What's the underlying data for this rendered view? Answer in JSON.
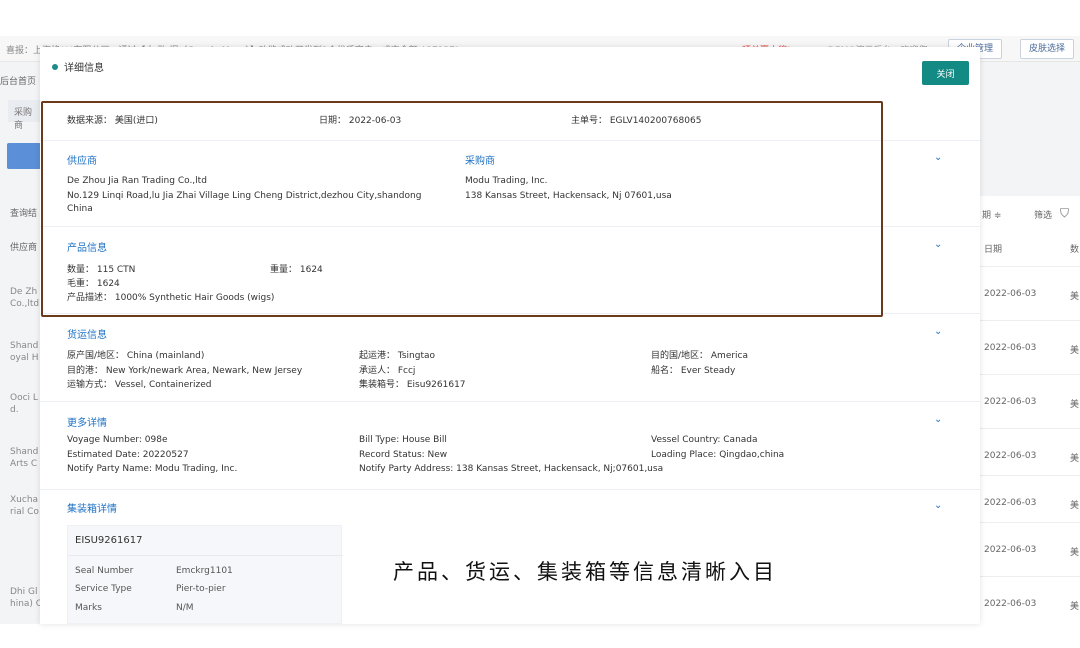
{
  "background": {
    "notice": "喜报：上海格***有限公司，通过【大 数 据（Google Maps）】功能成功开发到1个优质客户，成交金额 $17137!",
    "red_link": "晒单赢大奖!",
    "demo_text": "DEMO演示后台，欢迎您",
    "btn_enterprise": "企业管理",
    "btn_skin": "皮肤选择",
    "nav_home": "后台首页",
    "tab_purchase": "采购商",
    "label_query": "查询结",
    "label_supplier": "供应商",
    "right_hdr_date_sort": "期 ≑",
    "right_hdr_filter": "筛选",
    "right_hdr_date": "日期",
    "right_hdr_count": "数",
    "left_rows": [
      "De Zh",
      "Co.,ltd",
      "Shand",
      "oyal H",
      "Ooci L",
      "d.",
      "Shand",
      "Arts C",
      "Xucha",
      "rial Co",
      "Dhi Gl",
      "hina) C"
    ],
    "right_rows": [
      {
        "date": "2022-06-03",
        "mark": "美"
      },
      {
        "date": "2022-06-03",
        "mark": "美"
      },
      {
        "date": "2022-06-03",
        "mark": "美"
      },
      {
        "date": "2022-06-03",
        "mark": "美"
      },
      {
        "date": "2022-06-03",
        "mark": "美"
      },
      {
        "date": "2022-06-03",
        "mark": "美"
      },
      {
        "date": "2022-06-03",
        "mark": "美"
      }
    ]
  },
  "modal": {
    "title": "详细信息",
    "close_label": "关闭",
    "summary": {
      "source": "数据来源：  美国(进口)",
      "date": "日期：  2022-06-03",
      "master_no": "主单号：  EGLV140200768065"
    },
    "supplier": {
      "title": "供应商",
      "name": "De Zhou Jia Ran Trading Co.,ltd",
      "addr1": "No.129 Linqi Road,lu Jia Zhai Village Ling Cheng District,dezhou City,shandong",
      "addr2": "China"
    },
    "buyer": {
      "title": "采购商",
      "name": "Modu Trading, Inc.",
      "addr": "138 Kansas Street, Hackensack, Nj 07601,usa"
    },
    "product": {
      "title": "产品信息",
      "quantity": "数量：  115 CTN",
      "weight": "重量：  1624",
      "gross_weight": "毛重：  1624",
      "description": "产品描述：  1000% Synthetic Hair Goods (wigs)"
    },
    "shipping": {
      "title": "货运信息",
      "origin": "原产国/地区：  China (mainland)",
      "dest_port": "目的港：  New York/newark Area, Newark, New Jersey",
      "transport": "运输方式：  Vessel, Containerized",
      "depart_port": "起运港：  Tsingtao",
      "carrier": "承运人：  Fccj",
      "container_no": "集装箱号：  Eisu9261617",
      "dest_country": "目的国/地区：  America",
      "vessel": "船名：  Ever Steady"
    },
    "more": {
      "title": "更多详情",
      "voyage": "Voyage Number:  098e",
      "est_date": "Estimated Date:  20220527",
      "notify_name": "Notify Party Name:  Modu Trading, Inc.",
      "bill_type": "Bill Type:  House Bill",
      "record_status": "Record Status:  New",
      "notify_addr": "Notify Party Address:  138 Kansas Street, Hackensack, Nj;07601,usa",
      "vessel_country": "Vessel Country:  Canada",
      "loading_place": "Loading Place:  Qingdao,china"
    },
    "container": {
      "title": "集装箱详情",
      "id": "EISU9261617",
      "rows": [
        {
          "k": "Seal Number",
          "v": "Emckrg1101"
        },
        {
          "k": "Service Type",
          "v": "Pier-to-pier"
        },
        {
          "k": "Marks",
          "v": "N/M"
        }
      ]
    }
  },
  "caption": "产品、货运、集装箱等信息清晰入目",
  "colors": {
    "accent": "#148a84",
    "section_title": "#1f72c4",
    "highlight_border": "#6b3a1c"
  }
}
